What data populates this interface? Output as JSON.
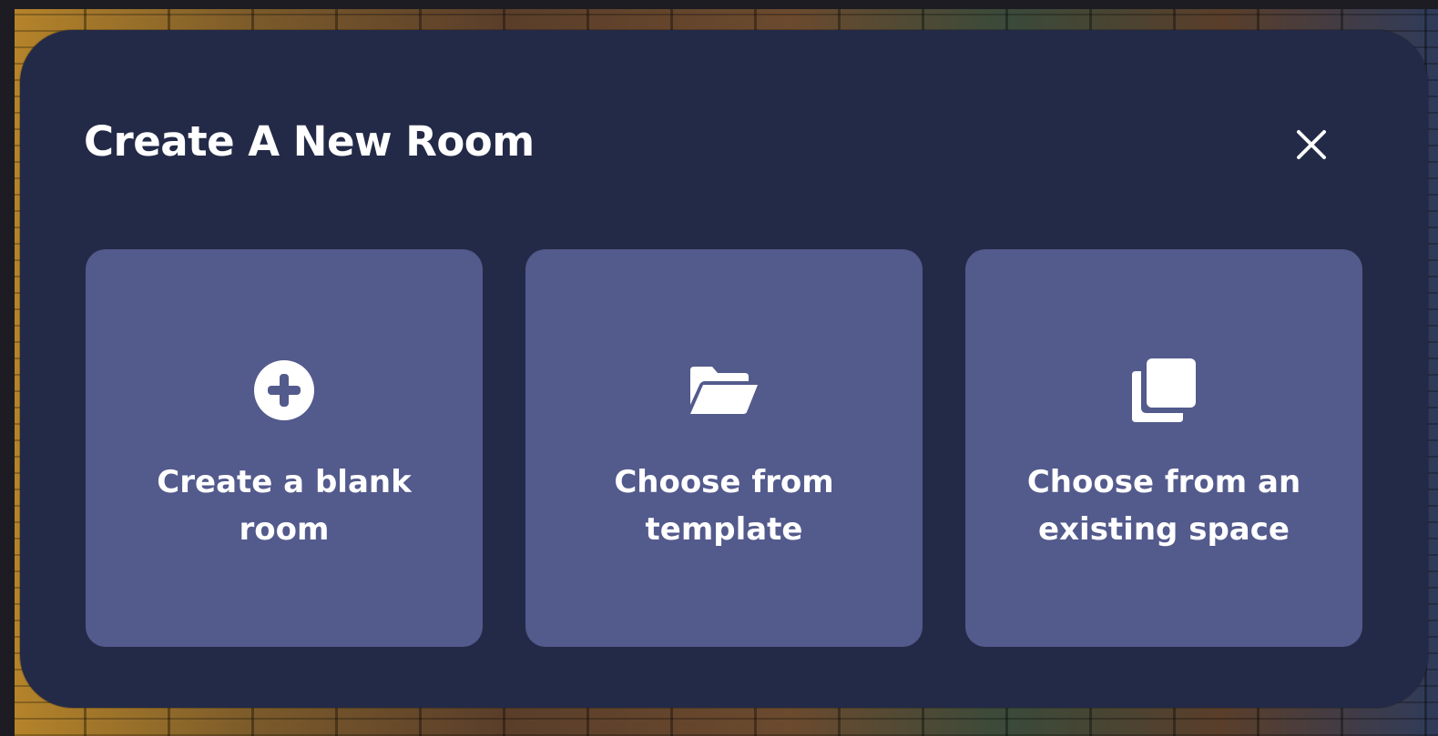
{
  "modal": {
    "title": "Create A New Room",
    "close_icon": "close-icon"
  },
  "options": [
    {
      "icon": "plus-circle-icon",
      "label_line1": "Create a blank",
      "label_line2": "room"
    },
    {
      "icon": "folder-open-icon",
      "label_line1": "Choose from",
      "label_line2": "template"
    },
    {
      "icon": "copy-icon",
      "label_line1": "Choose from an",
      "label_line2": "existing space"
    }
  ],
  "colors": {
    "modal_background": "#232a47",
    "card_background": "#535a8c",
    "text": "#ffffff"
  }
}
